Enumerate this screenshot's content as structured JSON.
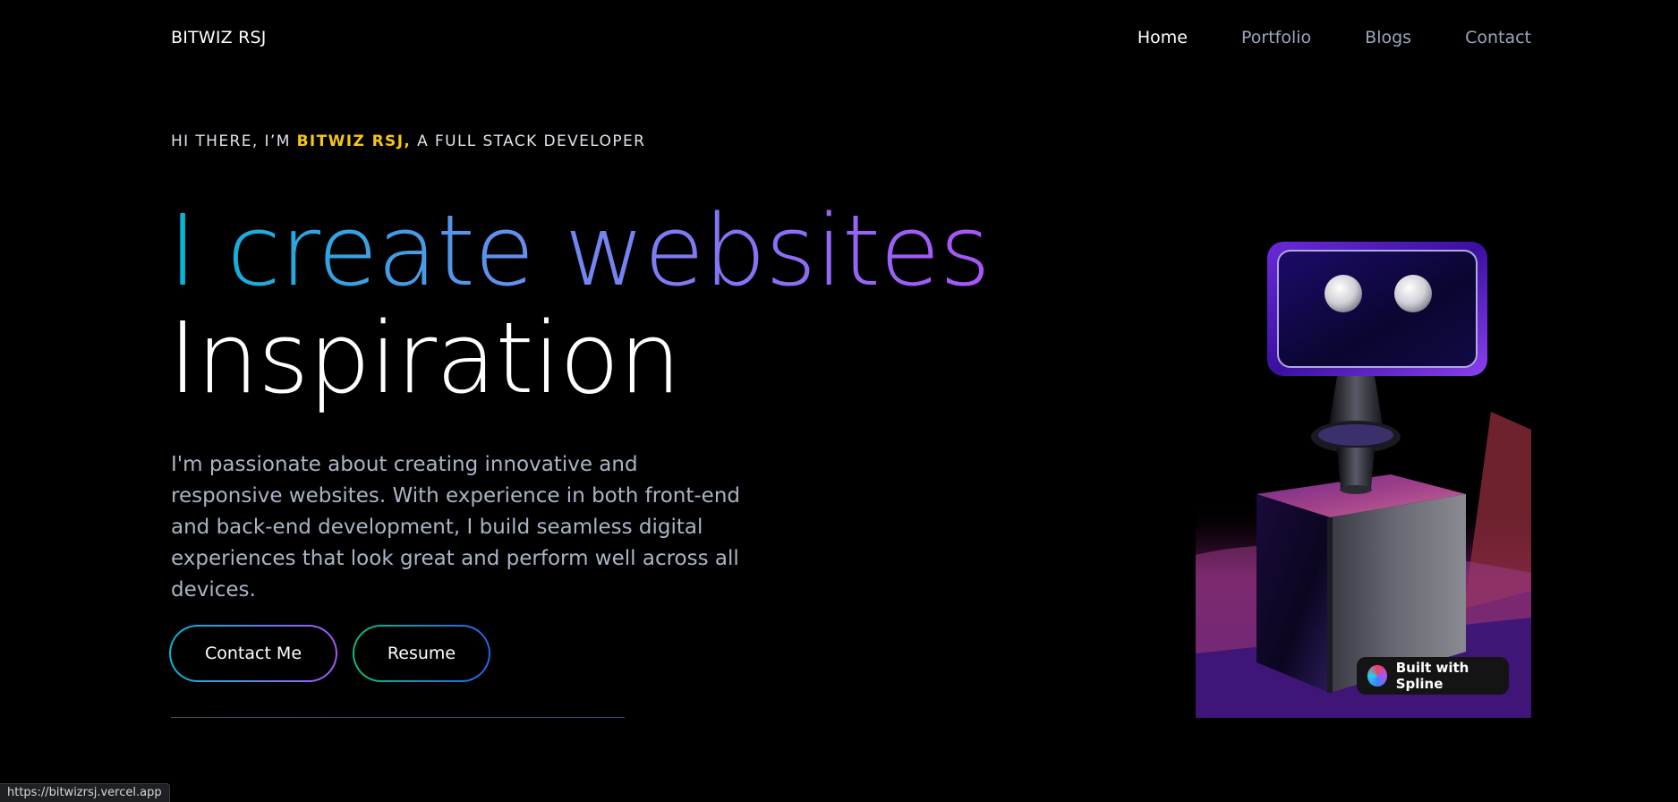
{
  "nav": {
    "brand": "BITWIZ RSJ",
    "links": [
      "Home",
      "Portfolio",
      "Blogs",
      "Contact"
    ]
  },
  "hero": {
    "intro_prefix": "HI THERE, I’M ",
    "intro_name": "BITWIZ RSJ,",
    "intro_suffix": " A FULL STACK DEVELOPER",
    "headline_line1": "I create websites",
    "headline_line2": "Inspiration",
    "paragraph": "I'm passionate about creating innovative and responsive websites. With experience in both front-end and back-end development, I build seamless digital experiences that look great and perform well across all devices.",
    "buttons": {
      "contact": "Contact Me",
      "resume": "Resume"
    }
  },
  "scene": {
    "badge_label": "Built with Spline"
  },
  "status_bar": {
    "url": "https://bitwizrsj.vercel.app"
  },
  "colors": {
    "accent_name": "#f5c518",
    "gradient_start": "#06b6d4",
    "gradient_end": "#a855f7",
    "nav_inactive": "#9aa6bd",
    "paragraph": "#aab4c6"
  }
}
